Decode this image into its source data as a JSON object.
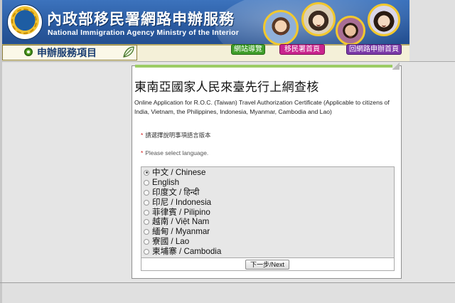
{
  "header": {
    "title": "內政部移民署網路申辦服務",
    "subtitle": "National Immigration Agency Ministry of the Interior",
    "menu_title": "申辦服務項目",
    "links": [
      {
        "label": "網站導覽",
        "color": "#3f9e2a"
      },
      {
        "label": "移民署首頁",
        "color": "#c9248e"
      },
      {
        "label": "回網路申辦首頁",
        "color": "#7b3aa8"
      }
    ]
  },
  "main": {
    "title": "東南亞國家人民來臺先行上網查核",
    "description": "Online Application for R.O.C. (Taiwan) Travel Authorization Certificate (Applicable to citizens of India, Vietnam, the Philippines, Indonesia, Myanmar, Cambodia and Lao)",
    "required_star": "*",
    "select_language_zh": "請選擇說明事項語言版本",
    "select_language_en": "Please select language.",
    "languages": [
      {
        "label": "中文 / Chinese",
        "selected": true
      },
      {
        "label": "English",
        "selected": false
      },
      {
        "label": "印度文 / हिन्दी",
        "selected": false
      },
      {
        "label": "印尼 / Indonesia",
        "selected": false
      },
      {
        "label": "菲律賓 / Pilipino",
        "selected": false
      },
      {
        "label": "越南 / Việt Nam",
        "selected": false
      },
      {
        "label": "緬甸 / Myanmar",
        "selected": false
      },
      {
        "label": "寮國 / Lao",
        "selected": false
      },
      {
        "label": "柬埔寨 / Cambodia",
        "selected": false
      }
    ],
    "next_button": "下一步/Next"
  },
  "colors": {
    "header_blue": "#2d61a8",
    "accent_green": "#9ccc65",
    "required_red": "#d21919"
  }
}
